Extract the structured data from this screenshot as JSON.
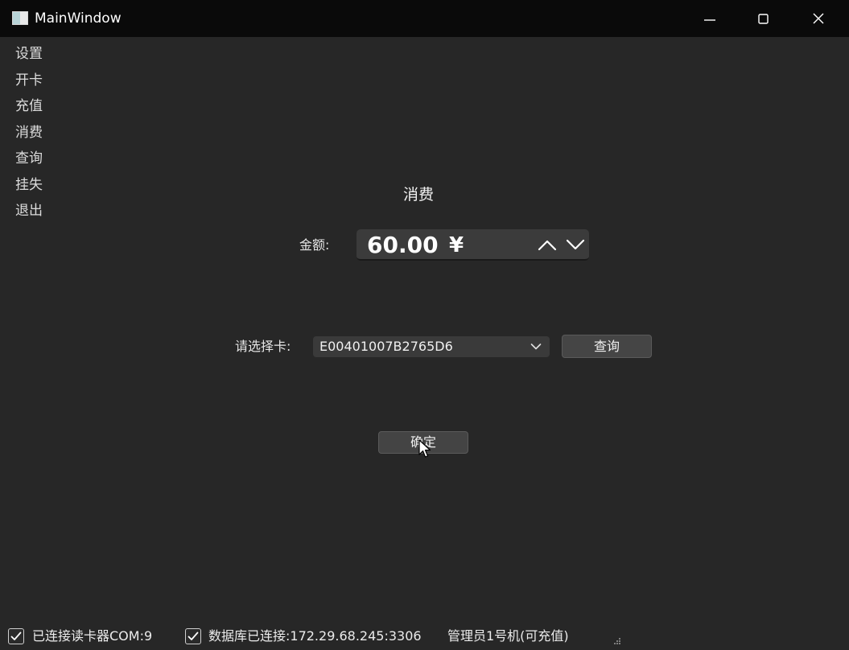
{
  "window": {
    "title": "MainWindow"
  },
  "sidebar": {
    "items": [
      {
        "label": "设置"
      },
      {
        "label": "开卡"
      },
      {
        "label": "充值"
      },
      {
        "label": "消费"
      },
      {
        "label": "查询"
      },
      {
        "label": "挂失"
      },
      {
        "label": "退出"
      }
    ]
  },
  "main": {
    "title": "消费",
    "amount": {
      "label": "金额:",
      "value": "60.00",
      "unit": "¥"
    },
    "card": {
      "label": "请选择卡:",
      "selected": "E00401007B2765D6"
    },
    "query_label": "查询",
    "confirm_label": "确定"
  },
  "status": {
    "reader_text": "已连接读卡器COM:9",
    "reader_checked": true,
    "db_text": "数据库已连接:172.29.68.245:3306",
    "db_checked": true,
    "admin_text": "管理员1号机(可充值)"
  },
  "icons": {
    "app": "app-window-icon",
    "minimize": "minimize-icon",
    "maximize": "maximize-icon",
    "close": "close-icon",
    "up": "chevron-up-icon",
    "down": "chevron-down-icon",
    "check": "checkmark-icon",
    "grip": "size-grip-icon",
    "cursor": "mouse-cursor-icon"
  },
  "colors": {
    "background": "#272727",
    "titlebar": "#0a0a0a",
    "control": "#3b3b3b",
    "text": "#f0f0f0"
  }
}
